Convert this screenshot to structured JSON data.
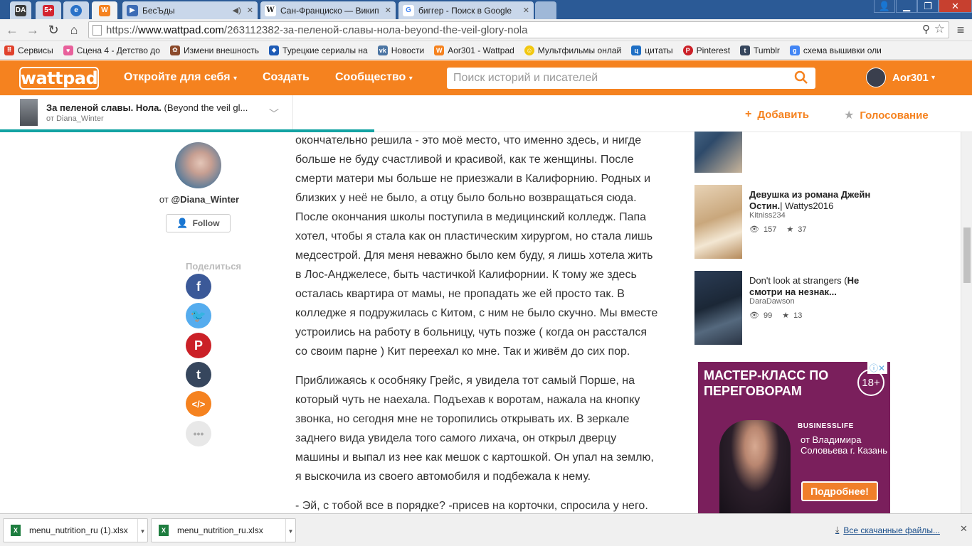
{
  "browser": {
    "tabs": [
      {
        "label": "",
        "icon": "DA",
        "pinned": true
      },
      {
        "label": "",
        "icon": "5+",
        "pinned": true
      },
      {
        "label": "",
        "icon": "e",
        "pinned": true
      },
      {
        "label": "",
        "icon": "W",
        "pinned": true
      },
      {
        "label": "БесЪды",
        "icon": "play",
        "audio": "◀)"
      },
      {
        "label": "Сан-Франциско — Викип",
        "icon": "W"
      },
      {
        "label": "биггер - Поиск в Google",
        "icon": "G"
      }
    ],
    "url_prefix": "https://",
    "url_domain": "www.wattpad.com",
    "url_path": "/263112382-за-пеленой-славы-нола-beyond-the-veil-glory-nola",
    "bookmarks": [
      {
        "label": "Сервисы",
        "icon": "apps",
        "color": "#e0412b"
      },
      {
        "label": "Сцена 4 - Детство до",
        "icon": "heart",
        "color": "#e8609b"
      },
      {
        "label": "Измени внешность",
        "icon": "cake",
        "color": "#8b4a2b"
      },
      {
        "label": "Турецкие сериалы на",
        "icon": "drop",
        "color": "#1e5bb5"
      },
      {
        "label": "Новости",
        "icon": "vk",
        "color": "#4c75a3"
      },
      {
        "label": "Aor301 - Wattpad",
        "icon": "wattpad",
        "color": "#f5821f"
      },
      {
        "label": "Мультфильмы онлай",
        "icon": "smile",
        "color": "#f2c811"
      },
      {
        "label": "цитаты",
        "icon": "ц",
        "color": "#1f6fc4"
      },
      {
        "label": "Pinterest",
        "icon": "pinterest",
        "color": "#cb2027"
      },
      {
        "label": "Tumblr",
        "icon": "tumblr",
        "color": "#36465d"
      },
      {
        "label": "схема вышивки оли",
        "icon": "g",
        "color": "#4285f4"
      }
    ]
  },
  "wattpad": {
    "logo": "wattpad",
    "nav": [
      "Откройте для себя",
      "Создать",
      "Сообщество"
    ],
    "search_placeholder": "Поиск историй и писателей",
    "username": "Aor301"
  },
  "storybar": {
    "title_bold": "За пеленой славы. Нола.",
    "title_rest": " (Beyond the veil gl...",
    "author": "от Diana_Winter",
    "add_label": "Добавить",
    "vote_label": "Голосование",
    "progress": 0.385
  },
  "author": {
    "by_prefix": "от ",
    "handle": "@Diana_Winter",
    "follow_label": "Follow",
    "share_label": "Поделиться"
  },
  "share_buttons": [
    {
      "name": "facebook",
      "glyph": "f",
      "color": "#3b5998"
    },
    {
      "name": "twitter",
      "glyph": "t",
      "color": "#55acee"
    },
    {
      "name": "pinterest",
      "glyph": "P",
      "color": "#cb2027"
    },
    {
      "name": "tumblr",
      "glyph": "t",
      "color": "#36465d"
    },
    {
      "name": "embed",
      "glyph": "</>",
      "color": "#f5821f"
    },
    {
      "name": "more",
      "glyph": "•••",
      "color": "#e8e8e8"
    }
  ],
  "story": {
    "paragraphs": [
      "окончательно решила - это моё место, что именно здесь, и нигде больше не буду счастливой и красивой, как те женщины. После смерти матери мы больше не приезжали в Калифорнию. Родных и близких у неё не было, а отцу было больно возвращаться сюда. После окончания школы поступила в медицинский колледж. Папа хотел, чтобы я стала как он пластическим хирургом, но стала лишь медсестрой. Для меня неважно было кем буду, я лишь хотела жить в Лос-Анджелесе, быть частичкой Калифорнии. К тому же здесь осталась квартира от мамы, не пропадать же ей просто так. В колледже я подружилась с Китом, с ним не было скучно. Мы вместе устроились на работу в больницу, чуть позже ( когда он расстался со своим парне ) Кит переехал ко мне. Так и живём до сих пор.",
      "Приближаясь к особняку Грейс, я увидела тот самый Порше, на который чуть не наехала. Подъехав к воротам, нажала на кнопку звонка, но сегодня мне не торопились открывать их. В зеркале заднего вида увидела того самого лихача, он открыл дверцу машины и выпал из нее как мешок с картошкой. Он упал на землю, я выскочила из своего автомобиля и подбежала к нему.",
      "- Эй, с тобой все в порядке? -присев на корточки, спросила у него."
    ]
  },
  "recommendations": [
    {
      "title_bold": "",
      "title_rest": "",
      "author": "",
      "views": "",
      "votes": ""
    },
    {
      "title_bold": "Девушка из романа Джейн Остин.",
      "title_rest": "| Wattys2016",
      "author": "Kitniss234",
      "views": "157",
      "votes": "37"
    },
    {
      "title_bold": "Не смотри на незнак...",
      "title_rest": "Don't look at strangers (",
      "author": "DaraDawson",
      "views": "99",
      "votes": "13"
    }
  ],
  "ad": {
    "title": "МАСТЕР-КЛАСС ПО ПЕРЕГОВОРАМ",
    "age": "18+",
    "close": "ⓘ✕",
    "brand": "BUSINESSLIFE",
    "subtitle": "от Владимира Соловьева г. Казань",
    "cta": "Подробнее!"
  },
  "downloads": {
    "items": [
      "menu_nutrition_ru (1).xlsx",
      "menu_nutrition_ru.xlsx"
    ],
    "all_label": "Все скачанные файлы...",
    "close": "✕"
  }
}
